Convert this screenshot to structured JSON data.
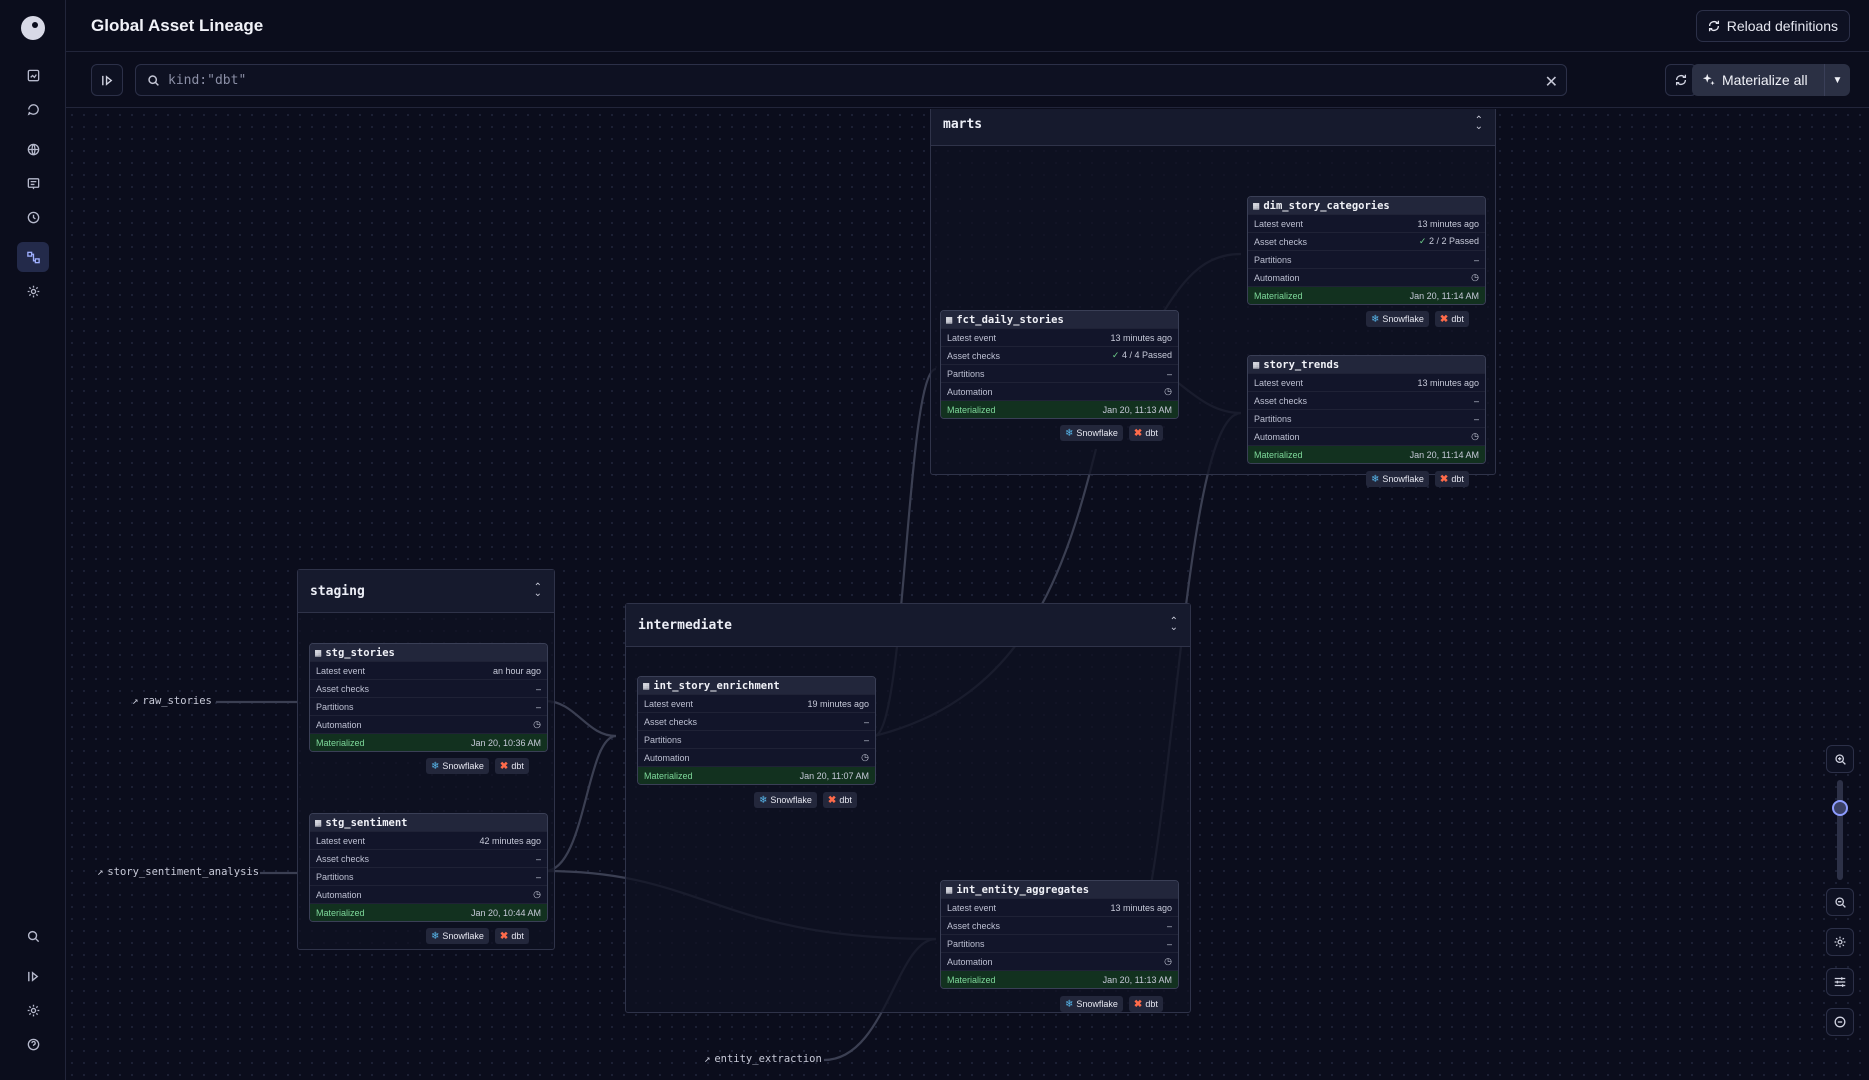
{
  "header": {
    "title": "Global Asset Lineage",
    "reload_label": "Reload definitions"
  },
  "sidebar": {
    "items": [
      {
        "icon": "overview-icon"
      },
      {
        "icon": "runs-icon"
      },
      {
        "icon": "deployment-icon"
      },
      {
        "icon": "jobs-icon"
      },
      {
        "icon": "schedules-icon"
      },
      {
        "icon": "asset-lineage-icon",
        "active": true
      },
      {
        "icon": "settings-icon"
      }
    ],
    "bottom": [
      {
        "icon": "search-icon"
      },
      {
        "icon": "collapse-sidebar-icon"
      },
      {
        "icon": "user-settings-icon"
      },
      {
        "icon": "help-icon"
      }
    ]
  },
  "toolbar": {
    "search_value": "kind:\"dbt\"",
    "materialize_label": "Materialize all"
  },
  "groups": {
    "marts": "marts",
    "staging": "staging",
    "intermediate": "intermediate"
  },
  "row_labels": {
    "latest": "Latest event",
    "checks": "Asset checks",
    "partitions": "Partitions",
    "automation": "Automation",
    "materialized": "Materialized"
  },
  "tags": {
    "snowflake": "Snowflake",
    "dbt": "dbt"
  },
  "assets": {
    "dim_story_categories": {
      "name": "dim_story_categories",
      "latest": "13 minutes ago",
      "checks": "2 / 2 Passed",
      "partitions": "–",
      "materialized": "Jan 20, 11:14 AM"
    },
    "fct_daily_stories": {
      "name": "fct_daily_stories",
      "latest": "13 minutes ago",
      "checks": "4 / 4 Passed",
      "partitions": "–",
      "materialized": "Jan 20, 11:13 AM"
    },
    "story_trends": {
      "name": "story_trends",
      "latest": "13 minutes ago",
      "checks": "–",
      "partitions": "–",
      "materialized": "Jan 20, 11:14 AM"
    },
    "stg_stories": {
      "name": "stg_stories",
      "latest": "an hour ago",
      "checks": "–",
      "partitions": "–",
      "materialized": "Jan 20, 10:36 AM"
    },
    "stg_sentiment": {
      "name": "stg_sentiment",
      "latest": "42 minutes ago",
      "checks": "–",
      "partitions": "–",
      "materialized": "Jan 20, 10:44 AM"
    },
    "int_story_enrichment": {
      "name": "int_story_enrichment",
      "latest": "19 minutes ago",
      "checks": "–",
      "partitions": "–",
      "materialized": "Jan 20, 11:07 AM"
    },
    "int_entity_aggregates": {
      "name": "int_entity_aggregates",
      "latest": "13 minutes ago",
      "checks": "–",
      "partitions": "–",
      "materialized": "Jan 20, 11:13 AM"
    }
  },
  "external_assets": {
    "raw_stories": "raw_stories",
    "story_sentiment_analysis": "story_sentiment_analysis",
    "entity_extraction": "entity_extraction"
  },
  "colors": {
    "background": "#0b0d1c",
    "materialized_green": "#7ed99a",
    "snowflake_blue": "#57b6ea",
    "dbt_orange": "#ff6b4a",
    "active_nav": "#9fb0ff"
  }
}
